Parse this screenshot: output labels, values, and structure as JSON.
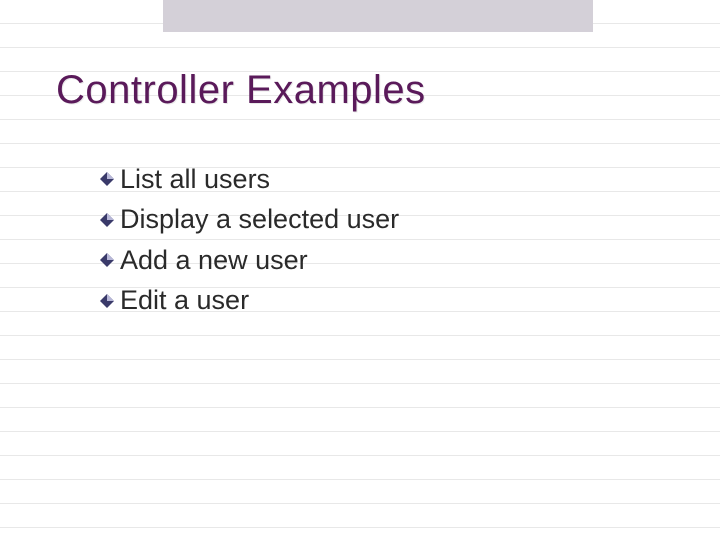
{
  "slide": {
    "title": "Controller Examples",
    "bullets": [
      {
        "text": "List all users"
      },
      {
        "text": "Display a selected user"
      },
      {
        "text": "Add a new user"
      },
      {
        "text": "Edit a user"
      }
    ]
  },
  "colors": {
    "title": "#5a1a5a",
    "bulletFill": "#3a3a6a",
    "bulletLight": "#b8b8d8"
  }
}
